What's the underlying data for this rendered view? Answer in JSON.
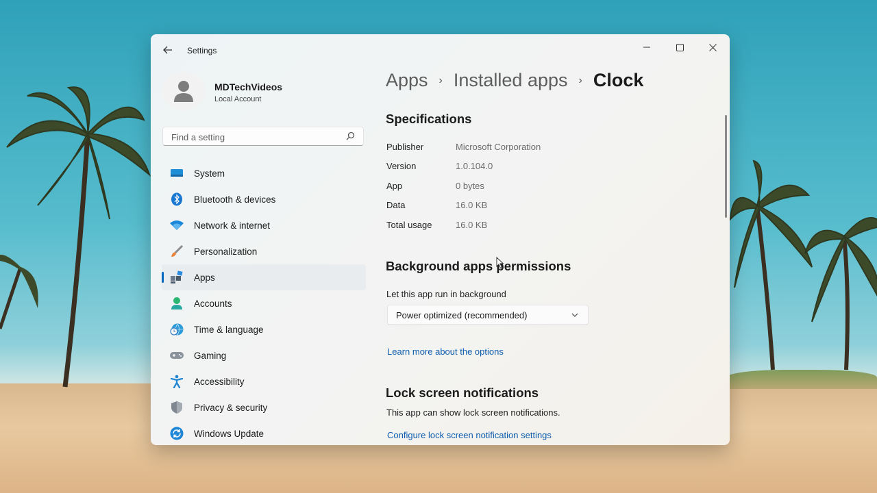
{
  "window": {
    "title": "Settings"
  },
  "profile": {
    "name": "MDTechVideos",
    "account_type": "Local Account"
  },
  "search": {
    "placeholder": "Find a setting"
  },
  "nav": [
    {
      "label": "System",
      "icon": "monitor-icon"
    },
    {
      "label": "Bluetooth & devices",
      "icon": "bluetooth-icon"
    },
    {
      "label": "Network & internet",
      "icon": "wifi-icon"
    },
    {
      "label": "Personalization",
      "icon": "brush-icon"
    },
    {
      "label": "Apps",
      "icon": "apps-icon",
      "active": true
    },
    {
      "label": "Accounts",
      "icon": "person-icon"
    },
    {
      "label": "Time & language",
      "icon": "globe-clock-icon"
    },
    {
      "label": "Gaming",
      "icon": "gamepad-icon"
    },
    {
      "label": "Accessibility",
      "icon": "accessibility-icon"
    },
    {
      "label": "Privacy & security",
      "icon": "shield-icon"
    },
    {
      "label": "Windows Update",
      "icon": "update-icon"
    }
  ],
  "breadcrumb": [
    "Apps",
    "Installed apps",
    "Clock"
  ],
  "specifications": {
    "title": "Specifications",
    "rows": [
      {
        "label": "Publisher",
        "value": "Microsoft Corporation"
      },
      {
        "label": "Version",
        "value": "1.0.104.0"
      },
      {
        "label": "App",
        "value": "0 bytes"
      },
      {
        "label": "Data",
        "value": "16.0 KB"
      },
      {
        "label": "Total usage",
        "value": "16.0 KB"
      }
    ]
  },
  "background": {
    "title": "Background apps permissions",
    "label": "Let this app run in background",
    "selected": "Power optimized (recommended)",
    "link": "Learn more about the options"
  },
  "lock_screen": {
    "title": "Lock screen notifications",
    "description": "This app can show lock screen notifications.",
    "link": "Configure lock screen notification settings"
  },
  "colors": {
    "accent": "#0067c0",
    "link": "#0b5cad"
  }
}
